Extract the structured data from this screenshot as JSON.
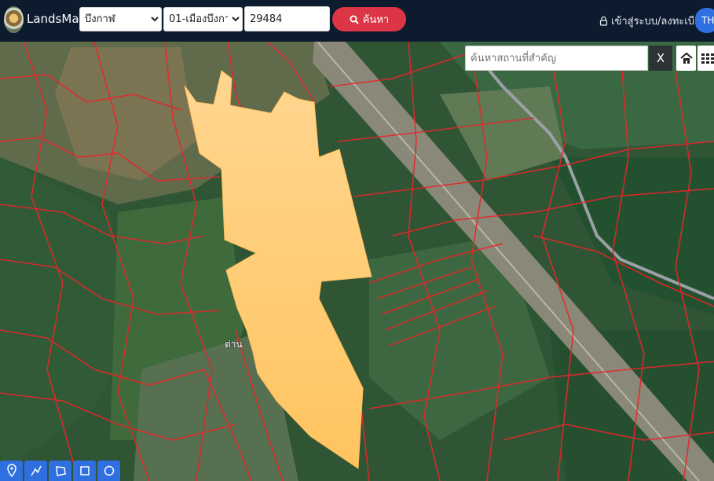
{
  "header": {
    "brand": "LandsMaps",
    "province": {
      "selected": "บึงกาฬ",
      "options": [
        "บึงกาฬ"
      ]
    },
    "district": {
      "selected": "01-เมืองบึงกาฬ",
      "options": [
        "01-เมืองบึงกาฬ"
      ]
    },
    "parcel_number": "29484",
    "search_label": "ค้นหา",
    "login_label": "เข้าสู่ระบบ/ลงทะเบียน",
    "language": "TH"
  },
  "map": {
    "place_search_placeholder": "ค้นหาสถานที่สำคัญ",
    "clear_label": "X",
    "partial_label": "ต่าน",
    "highlight_color": "#ffc870",
    "parcel_line_color": "#e8262a",
    "draw_tools": [
      "marker-icon",
      "polyline-icon",
      "polygon-icon",
      "rectangle-icon",
      "circle-icon"
    ]
  }
}
